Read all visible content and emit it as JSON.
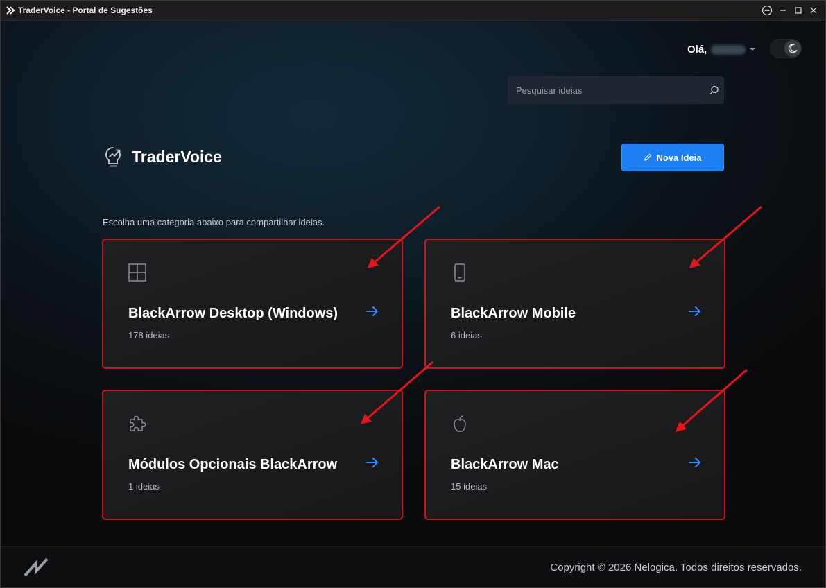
{
  "window": {
    "title": "TraderVoice - Portal de Sugestões"
  },
  "header": {
    "greeting": "Olá,",
    "search": {
      "placeholder": "Pesquisar ideias",
      "value": ""
    }
  },
  "brand": {
    "name": "TraderVoice"
  },
  "actions": {
    "new_idea_label": "Nova Ideia"
  },
  "main": {
    "subtitle": "Escolha uma categoria abaixo para compartilhar ideias.",
    "categories": [
      {
        "title": "BlackArrow Desktop (Windows)",
        "count": "178 ideias",
        "icon": "windows-icon"
      },
      {
        "title": "BlackArrow Mobile",
        "count": "6 ideias",
        "icon": "mobile-icon"
      },
      {
        "title": "Módulos Opcionais BlackArrow",
        "count": "1 ideias",
        "icon": "puzzle-icon"
      },
      {
        "title": "BlackArrow Mac",
        "count": "15 ideias",
        "icon": "apple-icon"
      }
    ]
  },
  "footer": {
    "copyright": "Copyright © 2026 Nelogica. Todos direitos reservados."
  },
  "colors": {
    "accent": "#1e7ff5",
    "annotation": "#e8141c",
    "arrow_link": "#2f8cff"
  }
}
